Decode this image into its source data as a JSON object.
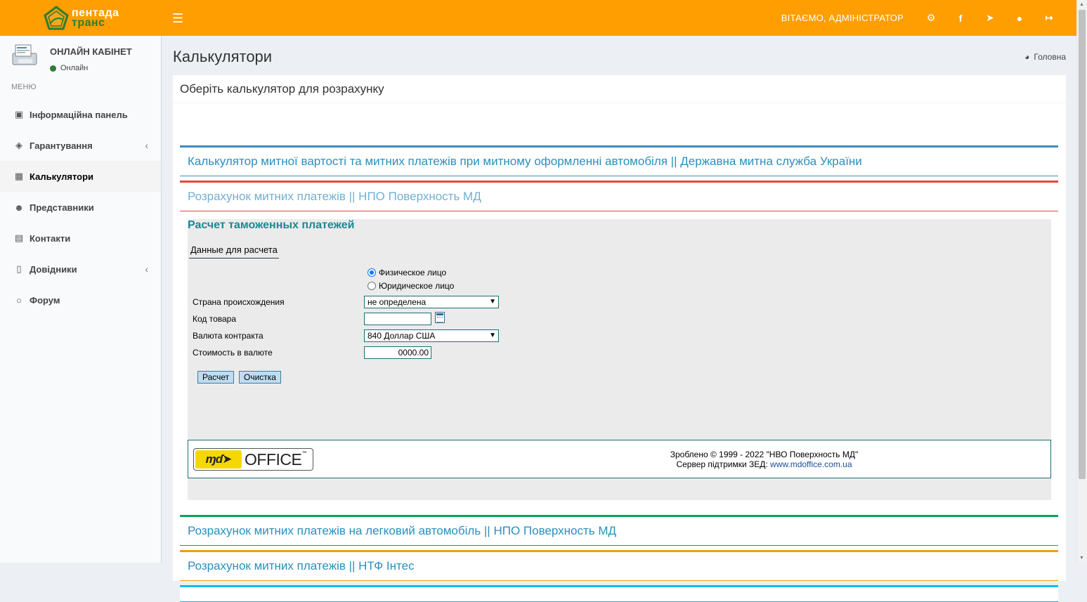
{
  "brand": {
    "line1": "пентада",
    "line2": "транс"
  },
  "topbar": {
    "menu_toggle_icon": "hamburger-icon",
    "welcome": "ВІТАЄМО, АДМІНІСТРАТОР",
    "icons": [
      "cogs-icon",
      "facebook-icon",
      "telegram-icon",
      "globe-icon",
      "sign-out-icon"
    ],
    "color": "#ff9e00"
  },
  "sidebar": {
    "user_name": "ОНЛАЙН КАБІНЕТ",
    "user_status": "Онлайн",
    "menu_header": "МЕНЮ",
    "items": [
      {
        "label": "Інформаційна панель",
        "icon": "desktop-icon",
        "has_submenu": false,
        "active": false
      },
      {
        "label": "Гарантування",
        "icon": "shield-icon",
        "has_submenu": true,
        "active": false
      },
      {
        "label": "Калькулятори",
        "icon": "calculator-icon",
        "has_submenu": false,
        "active": true
      },
      {
        "label": "Представники",
        "icon": "users-icon",
        "has_submenu": false,
        "active": false
      },
      {
        "label": "Контакти",
        "icon": "address-book-icon",
        "has_submenu": false,
        "active": false
      },
      {
        "label": "Довідники",
        "icon": "book-icon",
        "has_submenu": true,
        "active": false
      },
      {
        "label": "Форум",
        "icon": "comments-icon",
        "has_submenu": false,
        "active": false
      }
    ]
  },
  "page": {
    "title": "Калькулятори",
    "breadcrumb": "Головна",
    "box_title": "Оберіть калькулятор для розрахунку"
  },
  "panels": [
    {
      "title": "Калькулятор митної вартості та митних платежів при митному оформленні автомобіля || Державна митна служба України",
      "color": "#3c8dbc"
    },
    {
      "title": "Розрахунок митних платежів || НПО Поверхность МД",
      "color": "#dd4b39"
    },
    {
      "title": "Розрахунок митних платежів на легковий автомобіль || НПО Поверхность МД",
      "color": "#00a65a"
    },
    {
      "title": "Розрахунок митних платежів || НТФ Інтес",
      "color": "#f39c12"
    },
    {
      "title": "",
      "color": "#00c0ef"
    }
  ],
  "calc": {
    "heading": "Расчет таможенных платежей",
    "tab": "Данные для расчета",
    "radio_physical": "Физическое лицо",
    "radio_legal": "Юридическое лицо",
    "country_label": "Страна происхождения",
    "country_value": "не определена",
    "code_label": "Код товара",
    "code_value": "",
    "currency_label": "Валюта контракта",
    "currency_value": "840 Доллар США",
    "cost_label": "Стоимость в валюте",
    "cost_value": "0000.00",
    "calc_button": "Расчет",
    "clear_button": "Очистка",
    "logo_text": "OFFICE",
    "logo_tm": "™",
    "footer_line1": "Зроблено © 1999 - 2022 \"НВО Поверхность МД\"",
    "footer_line2_prefix": "Сервер підтримки ЗЕД: ",
    "footer_link": "www.mdoffice.com.ua"
  }
}
